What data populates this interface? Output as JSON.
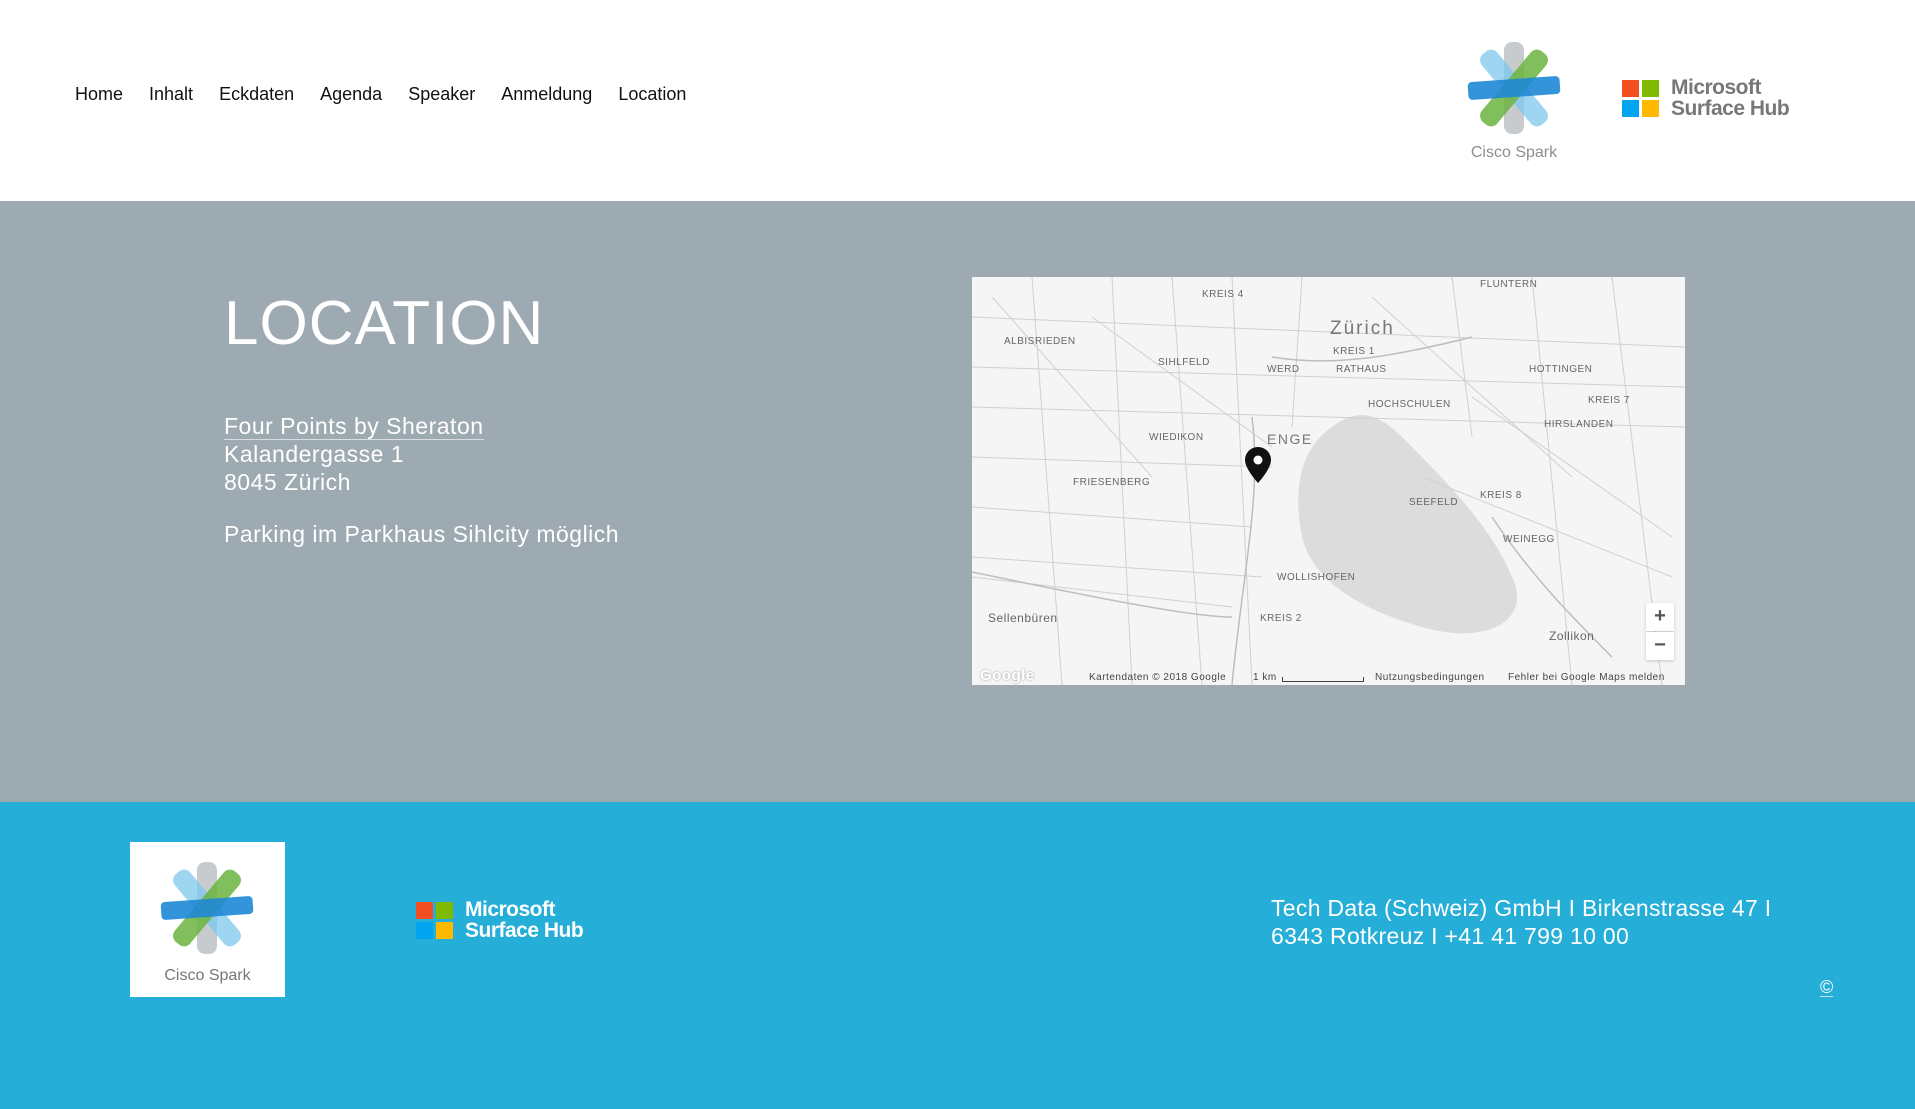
{
  "nav": {
    "items": [
      {
        "label": "Home"
      },
      {
        "label": "Inhalt"
      },
      {
        "label": "Eckdaten"
      },
      {
        "label": "Agenda"
      },
      {
        "label": "Speaker"
      },
      {
        "label": "Anmeldung"
      },
      {
        "label": "Location"
      }
    ]
  },
  "brand": {
    "cisco_label": "Cisco Spark",
    "ms_line1": "Microsoft",
    "ms_line2": "Surface Hub"
  },
  "location": {
    "title": "LOCATION",
    "hotel": "Four Points by Sheraton",
    "street": "Kalandergasse 1",
    "city": "8045 Zürich",
    "parking": "Parking im Parkhaus Sihlcity möglich"
  },
  "map": {
    "city_label": "Zürich",
    "district_labels": {
      "enge": "ENGE",
      "kreis4": "KREIS 4",
      "fluntern": "FLUNTERN",
      "albisrieden": "ALBISRIEDEN",
      "sihlfeld": "SIHLFELD",
      "werd": "WERD",
      "kreis1": "KREIS 1",
      "rathaus": "RATHAUS",
      "hottingen": "HOTTINGEN",
      "hochschulen": "HOCHSCHULEN",
      "kreis7": "KREIS 7",
      "hirslanden": "HIRSLANDEN",
      "wiedikon": "WIEDIKON",
      "friesenberg": "FRIESENBERG",
      "seefeld": "SEEFELD",
      "kreis8": "KREIS 8",
      "weinegg": "WEINEGG",
      "wollishofen": "WOLLISHOFEN",
      "kreis2": "KREIS 2",
      "sellenbueren": "Sellenbüren",
      "zollikon": "Zollikon"
    },
    "footer": {
      "google": "Google",
      "credit": "Kartendaten © 2018 Google",
      "scale": "1 km",
      "terms": "Nutzungsbedingungen",
      "report": "Fehler bei Google Maps melden"
    },
    "zoom_in": "+",
    "zoom_out": "−"
  },
  "footer": {
    "cisco_label": "Cisco Spark",
    "ms_line1": "Microsoft",
    "ms_line2": "Surface Hub",
    "address_line1": "Tech Data (Schweiz) GmbH I Birkenstrasse 47 I",
    "address_line2": "6343 Rotkreuz I +41 41 799 10 00",
    "copyright": "©"
  },
  "colors": {
    "main_bg": "#9eaab2",
    "footer_bg": "#25aed7",
    "ms_red": "#f25022",
    "ms_green": "#7fba00",
    "ms_blue": "#00a4ef",
    "ms_yellow": "#ffb900",
    "cisco_blue": "#1e88d6",
    "cisco_green": "#6ab43e"
  }
}
